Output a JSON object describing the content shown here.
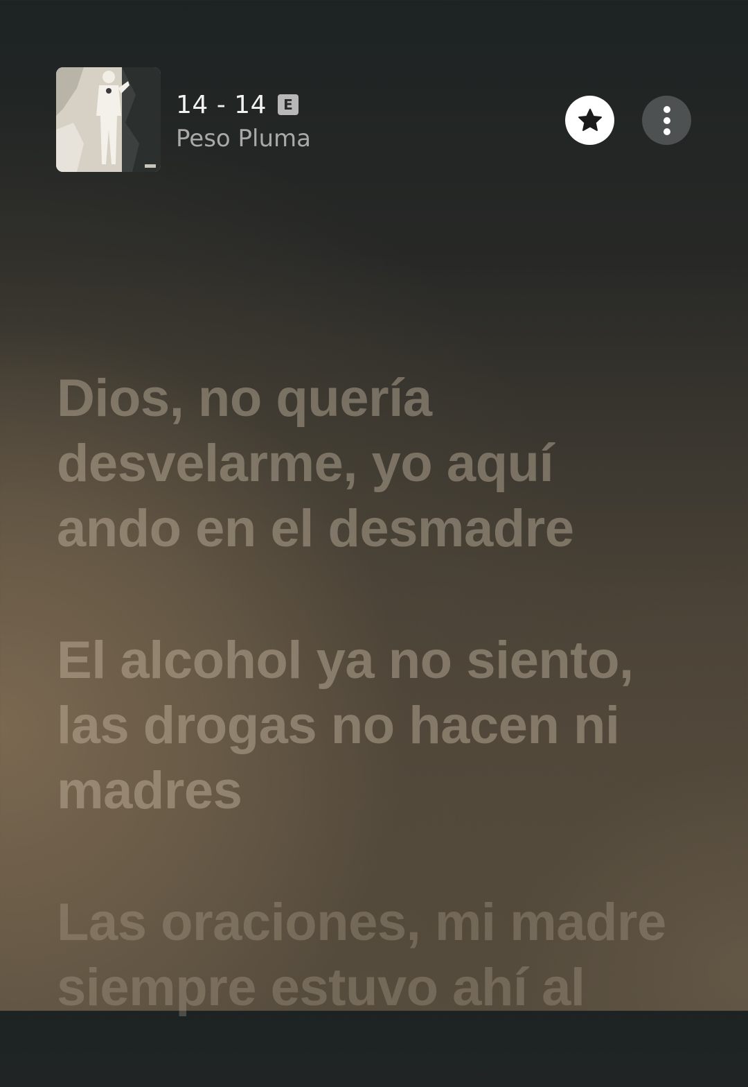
{
  "now_playing": {
    "title": "14 - 14",
    "explicit_badge": "E",
    "artist": "Peso Pluma",
    "album_art_icon": "album-art-image"
  },
  "actions": {
    "favorite_icon": "star-icon",
    "more_icon": "vertical-ellipsis-icon"
  },
  "lyrics": {
    "lines": [
      "Dios, no quería\ndesvelarme, yo aquí\nando en el desmadre",
      "El alcohol ya no siento,\nlas drogas no hacen ni\nmadres",
      "Las oraciones, mi madre\nsiempre estuvo ahí al"
    ]
  },
  "colors": {
    "lyric_text": "#cdbeaa",
    "background_top": "#1d2323",
    "background_bottom": "#5a4f40",
    "star_button_bg": "#ffffff",
    "more_button_bg": "#4d5152"
  }
}
